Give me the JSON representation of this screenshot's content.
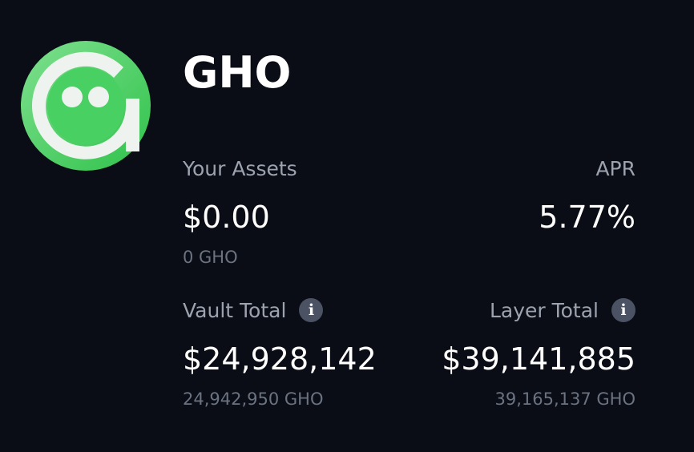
{
  "token": {
    "name": "GHO",
    "logo_icon": "gho-token-icon",
    "brand_color": "#3bd159"
  },
  "assets": {
    "label": "Your Assets",
    "value": "$0.00",
    "sub": "0 GHO"
  },
  "apr": {
    "label": "APR",
    "value": "5.77%"
  },
  "vault_total": {
    "label": "Vault Total",
    "value": "$24,928,142",
    "sub": "24,942,950 GHO",
    "icon": "info-icon"
  },
  "layer_total": {
    "label": "Layer Total",
    "value": "$39,141,885",
    "sub": "39,165,137 GHO",
    "icon": "info-icon"
  },
  "colors": {
    "background": "#0a0d15",
    "muted_text": "#9ca3af",
    "sub_text": "#6b7280",
    "info_icon_bg": "#4b5263"
  }
}
